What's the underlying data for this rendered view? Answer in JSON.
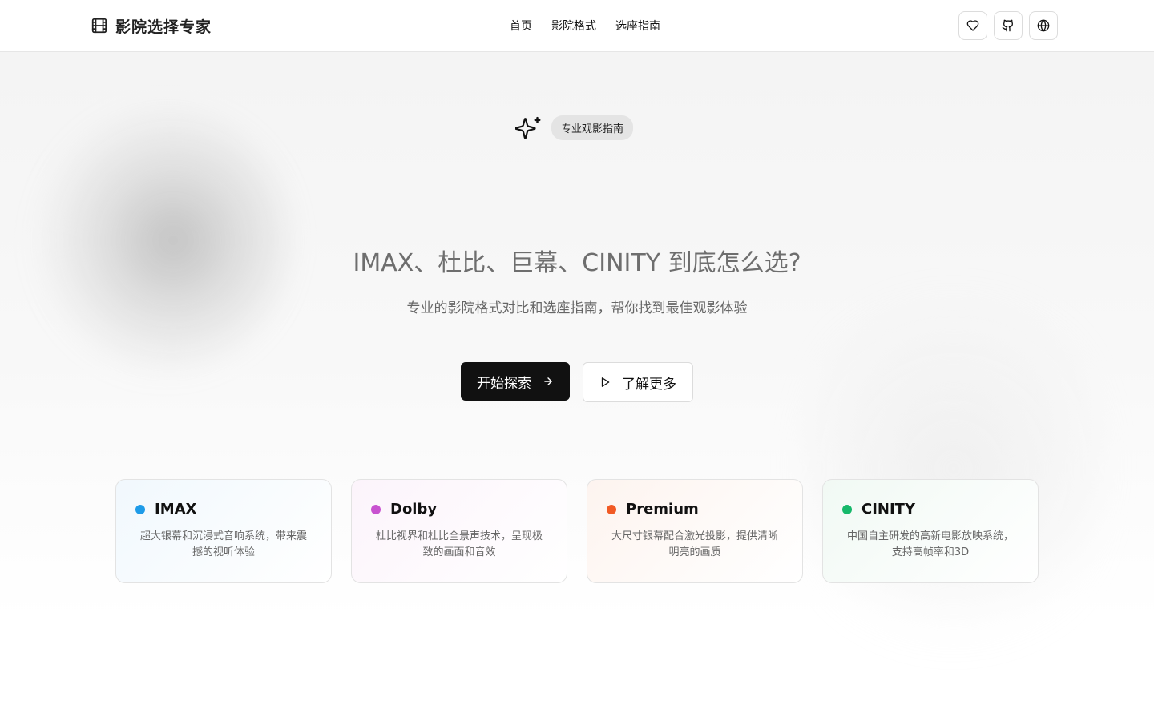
{
  "header": {
    "brand": "影院选择专家",
    "nav": [
      "首页",
      "影院格式",
      "选座指南"
    ],
    "icons": [
      "heart-icon",
      "github-icon",
      "globe-icon"
    ]
  },
  "hero": {
    "badge": "专业观影指南",
    "title": "IMAX、杜比、巨幕、CINITY 到底怎么选?",
    "subtitle": "专业的影院格式对比和选座指南，帮你找到最佳观影体验",
    "primary_cta": "开始探索",
    "secondary_cta": "了解更多"
  },
  "cards": [
    {
      "title": "IMAX",
      "desc": "超大银幕和沉浸式音响系统，带来震撼的视听体验",
      "color": "#1e9be8",
      "bg": "#f1f8fd"
    },
    {
      "title": "Dolby",
      "desc": "杜比视界和杜比全景声技术，呈现极致的画面和音效",
      "color": "#c852d0",
      "bg": "#fcf4fb"
    },
    {
      "title": "Premium",
      "desc": "大尺寸银幕配合激光投影，提供清晰明亮的画质",
      "color": "#f15a24",
      "bg": "#fdf4ef"
    },
    {
      "title": "CINITY",
      "desc": "中国自主研发的高新电影放映系统，支持高帧率和3D",
      "color": "#16b86a",
      "bg": "#f1f9f4"
    }
  ]
}
